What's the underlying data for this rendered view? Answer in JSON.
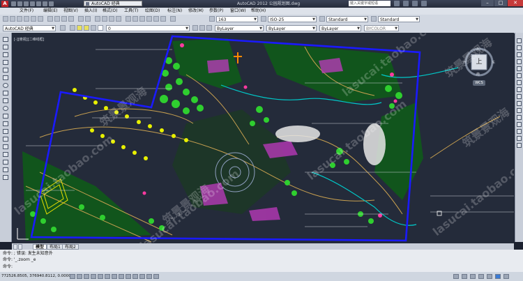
{
  "title_bar": {
    "workspace": "AutoCAD 经典",
    "app_title": "AutoCAD 2012 公园规划图.dwg",
    "search_placeholder": "键入关键字或短语"
  },
  "menu": [
    "文件(F)",
    "编辑(E)",
    "视图(V)",
    "插入(I)",
    "格式(O)",
    "工具(T)",
    "绘图(D)",
    "标注(N)",
    "修改(M)",
    "参数(P)",
    "窗口(W)",
    "帮助(H)"
  ],
  "toolbar1": {
    "text_style": "163",
    "dim_style": "ISO-25",
    "table_style": "Standard",
    "mleader_style": "Standard"
  },
  "toolbar2": {
    "workspace": "AutoCAD 经典",
    "layer": "0",
    "color": "ByLayer",
    "linetype": "ByLayer",
    "lineweight": "ByLayer",
    "plotstyle": "BYCOLOR"
  },
  "viewport_label": "[-][俯视][二维线框]",
  "viewcube": {
    "face": "上",
    "north": "北",
    "south": "南",
    "west": "西",
    "east": "东",
    "wcs": "WCS"
  },
  "tabs": [
    "模型",
    "布局1",
    "布局2"
  ],
  "command_lines": [
    "命令: ; 错误: 发生未知意外",
    "命令: '_.zoom _e",
    "命令:"
  ],
  "status": {
    "coords": "772526.8505, 376940.8112, 0.0000"
  },
  "watermarks": [
    "筑景景观海",
    "lasucai.taobao.com",
    "筑景景观海",
    "lasucai.taobao.com",
    "lasucai.taobao.com",
    "筑景景观海",
    "筑景景观海",
    "lasucai.taobao.com",
    "lasucai.taobao.com"
  ],
  "colors": {
    "boundary": "#1a1aff",
    "canvas_bg": "#242b3a",
    "vegetation": "#2fcf2f",
    "path": "#c8a050",
    "water": "#00c8c8",
    "magenta": "#d040d0",
    "tree_yellow": "#e8f000"
  }
}
